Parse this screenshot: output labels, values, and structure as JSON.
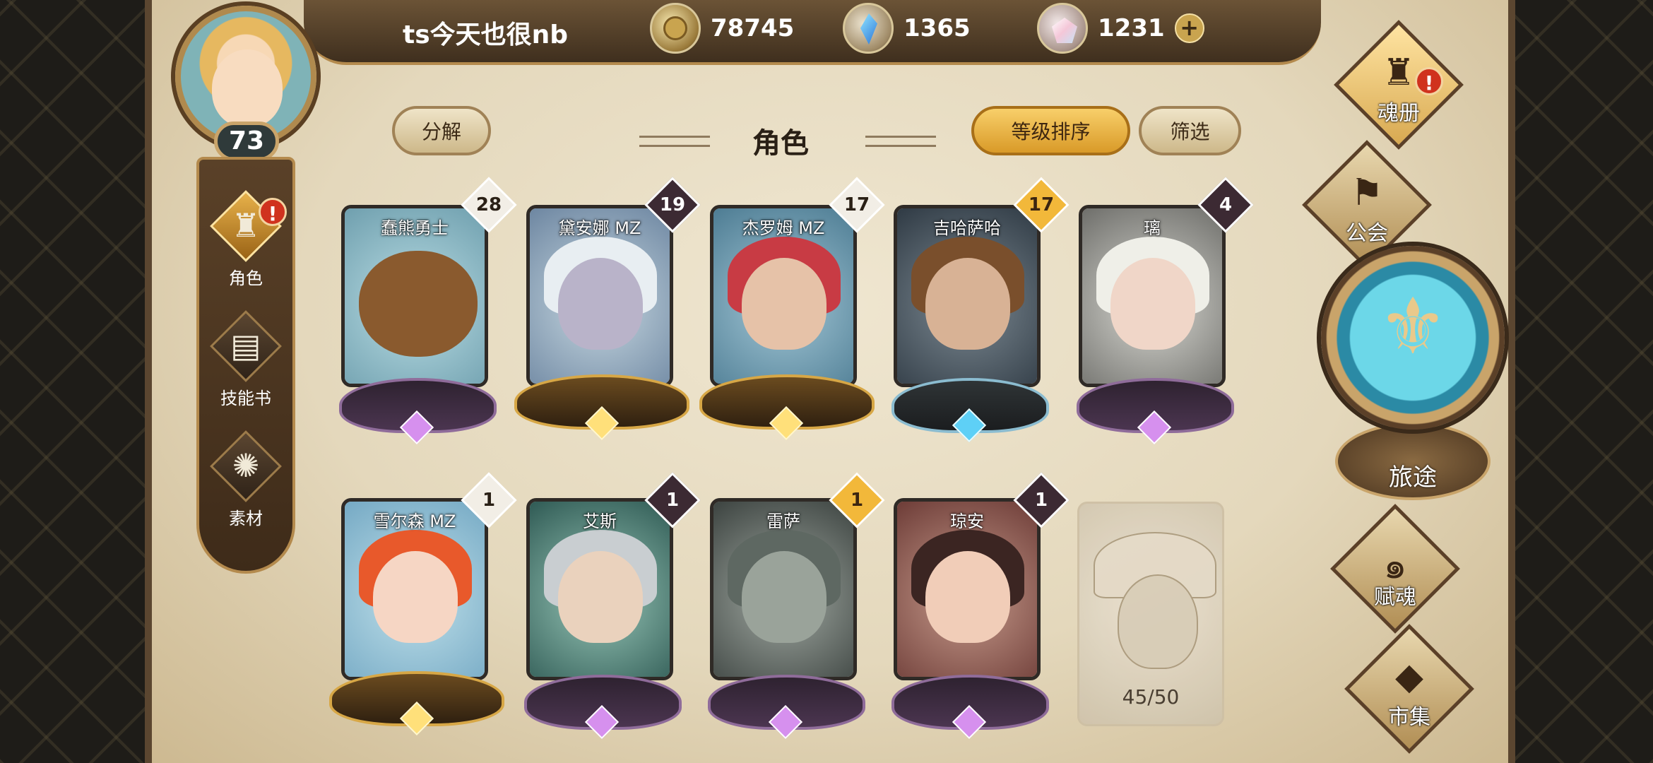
{
  "header": {
    "player_name": "ts今天也很nb",
    "gold": "78745",
    "crystal": "1365",
    "shard": "1231",
    "plus": "+"
  },
  "player": {
    "level": "73"
  },
  "left_nav": [
    {
      "label": "角色",
      "icon": "helmet-icon",
      "alert": "!"
    },
    {
      "label": "技能书",
      "icon": "book-icon"
    },
    {
      "label": "素材",
      "icon": "material-icon"
    }
  ],
  "toolbar": {
    "decompose": "分解",
    "title": "角色",
    "sort": "等级排序",
    "filter": "筛选"
  },
  "cards": [
    {
      "name": "蠢熊勇士",
      "level": "28"
    },
    {
      "name": "黛安娜 MZ",
      "level": "19"
    },
    {
      "name": "杰罗姆 MZ",
      "level": "17"
    },
    {
      "name": "吉哈萨哈",
      "level": "17"
    },
    {
      "name": "璃",
      "level": "4"
    },
    {
      "name": "雪尔森 MZ",
      "level": "1"
    },
    {
      "name": "艾斯",
      "level": "1"
    },
    {
      "name": "雷萨",
      "level": "1"
    },
    {
      "name": "琼安",
      "level": "1"
    }
  ],
  "capacity": "45/50",
  "right_nav": {
    "soul_book": "魂册",
    "soul_book_alert": "!",
    "guild": "公会",
    "journey": "旅途",
    "endow": "赋魂",
    "market": "市集"
  },
  "colors": {
    "parchment": "#e9dec4",
    "gold_accent": "#d99a28",
    "alert_red": "#d0321e"
  }
}
